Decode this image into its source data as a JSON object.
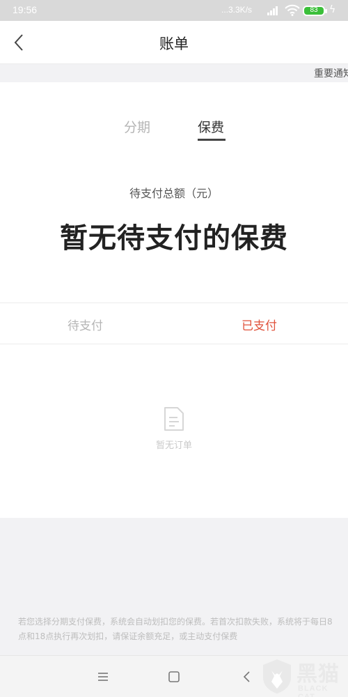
{
  "status_bar": {
    "time": "19:56",
    "speed": "...3.3K/s",
    "battery": "83",
    "icons": [
      "signal-icon",
      "wifi-icon",
      "battery-icon",
      "charging-icon"
    ]
  },
  "nav": {
    "title": "账单",
    "back_icon": "chevron-left-icon"
  },
  "notice": {
    "text": "重要通知"
  },
  "top_tabs": {
    "items": [
      {
        "label": "分期",
        "active": false
      },
      {
        "label": "保费",
        "active": true
      }
    ]
  },
  "summary": {
    "label": "待支付总额（元）",
    "value": "暂无待支付的保费"
  },
  "sub_tabs": {
    "items": [
      {
        "label": "待支付",
        "active": false
      },
      {
        "label": "已支付",
        "active": true
      }
    ]
  },
  "empty_state": {
    "icon": "document-icon",
    "text": "暂无订单"
  },
  "footnote": "若您选择分期支付保费，系统会自动划扣您的保费。若首次扣款失败，系统将于每日8点和18点执行再次划扣，请保证余额充足，或主动支付保费",
  "system_nav": {
    "icons": [
      "menu-icon",
      "home-icon",
      "back-icon"
    ]
  },
  "watermark": {
    "logo_text": "黑猫",
    "logo_sub": "BLACK CAT"
  },
  "colors": {
    "accent_red": "#e0523b",
    "inactive_gray": "#b5b5b5",
    "status_bar_bg": "#d9d9d9",
    "battery_green": "#3bbf3a"
  }
}
